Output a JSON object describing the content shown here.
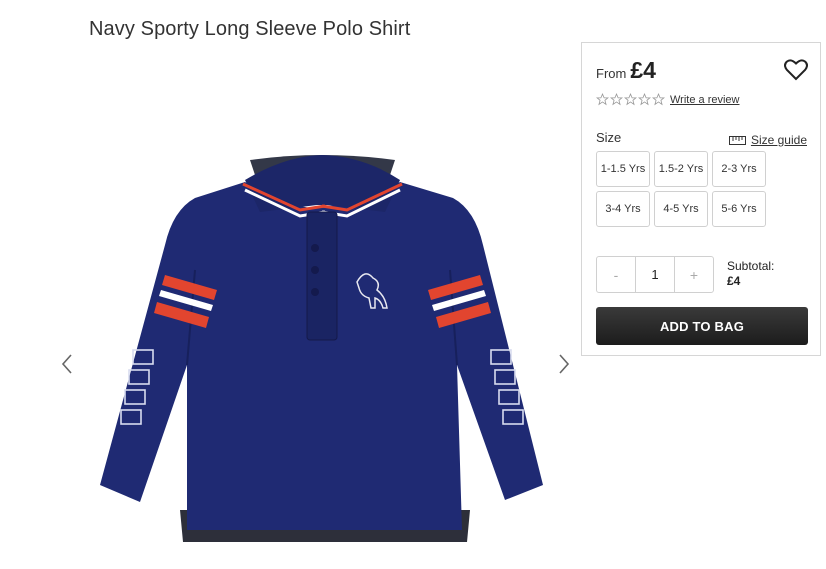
{
  "product": {
    "title": "Navy Sporty Long Sleeve Polo Shirt",
    "image_alt_icon": "polo-shirt-image"
  },
  "gallery": {
    "prev_icon": "chevron-left-icon",
    "next_icon": "chevron-right-icon"
  },
  "purchase": {
    "price_prefix": "From",
    "price": "£4",
    "wishlist_icon": "heart-icon",
    "rating": 0,
    "rating_max": 5,
    "review_link": "Write a review",
    "size_label": "Size",
    "size_guide_label": "Size guide",
    "sizes": [
      "1-1.5 Yrs",
      "1.5-2 Yrs",
      "2-3 Yrs",
      "3-4 Yrs",
      "4-5 Yrs",
      "5-6 Yrs"
    ],
    "quantity": {
      "decrement": "-",
      "value": "1",
      "increment": "+"
    },
    "subtotal_label": "Subtotal:",
    "subtotal_value": "£4",
    "add_to_bag": "ADD TO BAG"
  },
  "colors": {
    "shirt_navy": "#1f2a73",
    "stripe_red": "#e2452f",
    "button_dark": "#222222"
  }
}
